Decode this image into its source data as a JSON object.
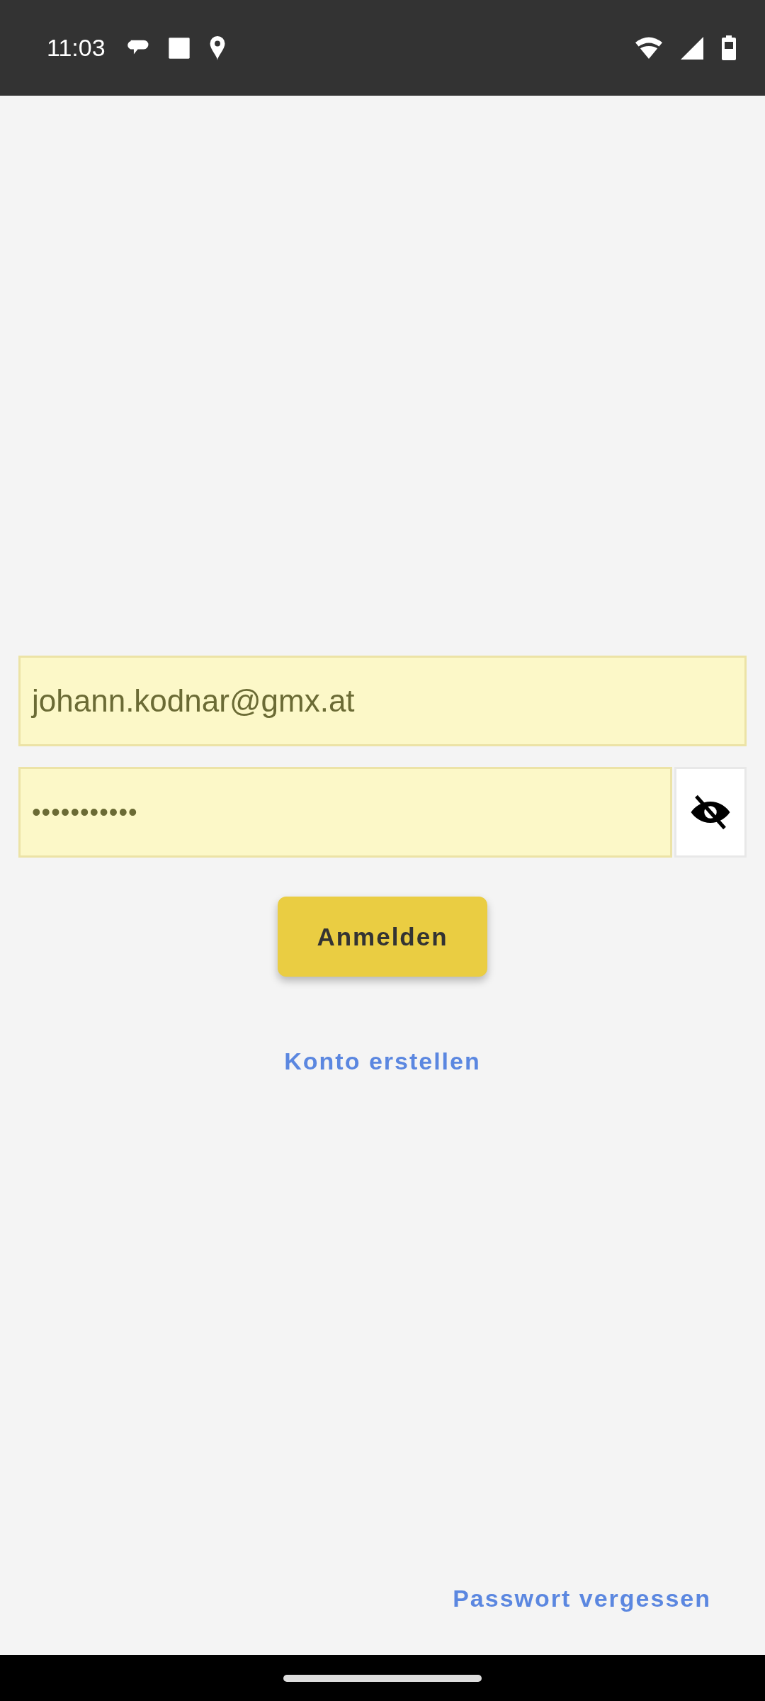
{
  "status_bar": {
    "time": "11:03"
  },
  "email_field": {
    "value": "johann.kodnar@gmx.at"
  },
  "password_field": {
    "value": "•••••••••••",
    "masked": true
  },
  "login_button": {
    "label": "Anmelden"
  },
  "create_account_link": {
    "label": "Konto erstellen"
  },
  "forgot_password_link": {
    "label": "Passwort vergessen"
  }
}
